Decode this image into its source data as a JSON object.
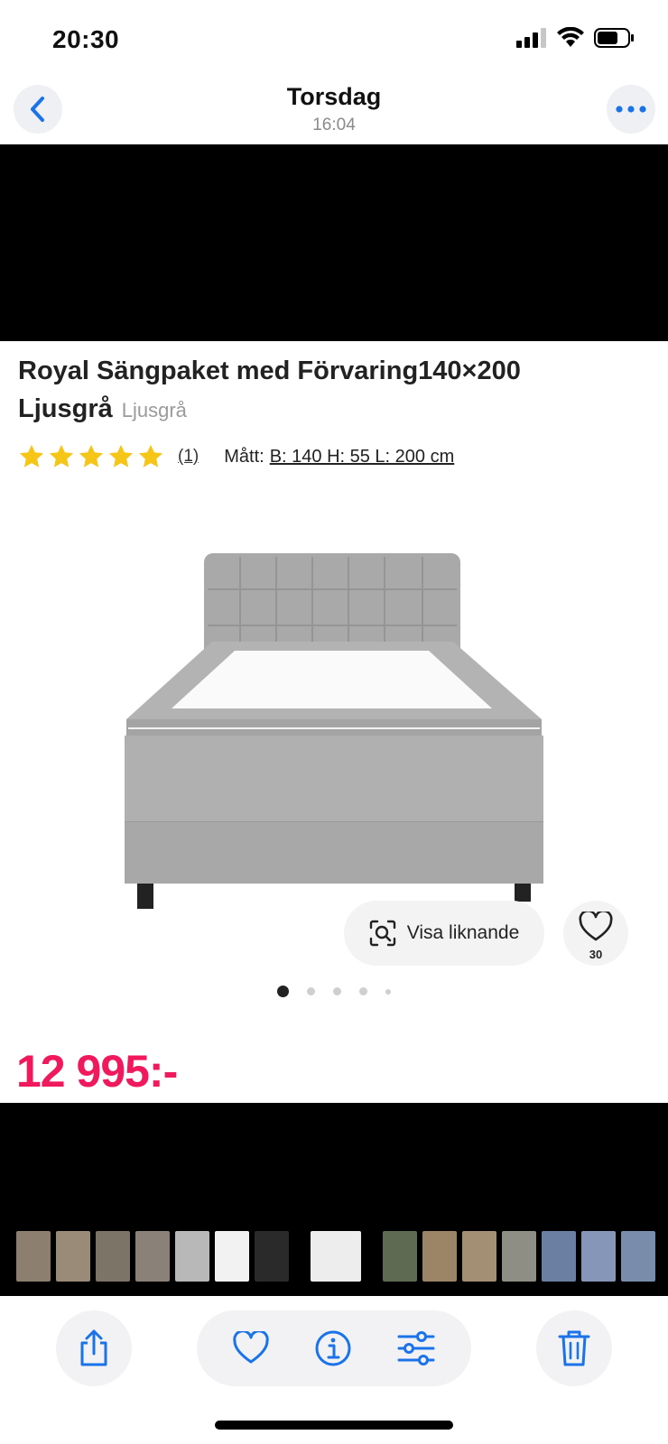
{
  "status_bar": {
    "time": "20:30"
  },
  "nav": {
    "title": "Torsdag",
    "subtitle": "16:04"
  },
  "product": {
    "title": "Royal Sängpaket med Förvaring140×200 Ljusgrå",
    "variant": "Ljusgrå",
    "rating_stars": 5,
    "review_count": "(1)",
    "dimensions_label": "Mått:",
    "dimensions_value": "B: 140 H: 55 L: 200 cm",
    "price": "12 995:-"
  },
  "actions": {
    "similar_label": "Visa liknande",
    "favorite_count": "30"
  },
  "carousel": {
    "total_dots": 5,
    "active_index": 0
  },
  "colors": {
    "accent": "#1a73e8",
    "price": "#f0195d",
    "star": "#f5c518"
  },
  "thumbnails": [
    "thumb-photo",
    "thumb-photo",
    "thumb-photo",
    "thumb-photo",
    "thumb-photo",
    "thumb-screenshot",
    "thumb-screenshot",
    "thumb-screenshot",
    "thumb-screenshot",
    "thumb-photo",
    "thumb-photo",
    "thumb-photo",
    "thumb-photo",
    "thumb-photo",
    "thumb-photo",
    "thumb-photo"
  ],
  "toolbar": {
    "share_icon": "share-icon",
    "heart_icon": "heart-icon",
    "info_icon": "info-icon",
    "adjust_icon": "sliders-icon",
    "trash_icon": "trash-icon"
  }
}
